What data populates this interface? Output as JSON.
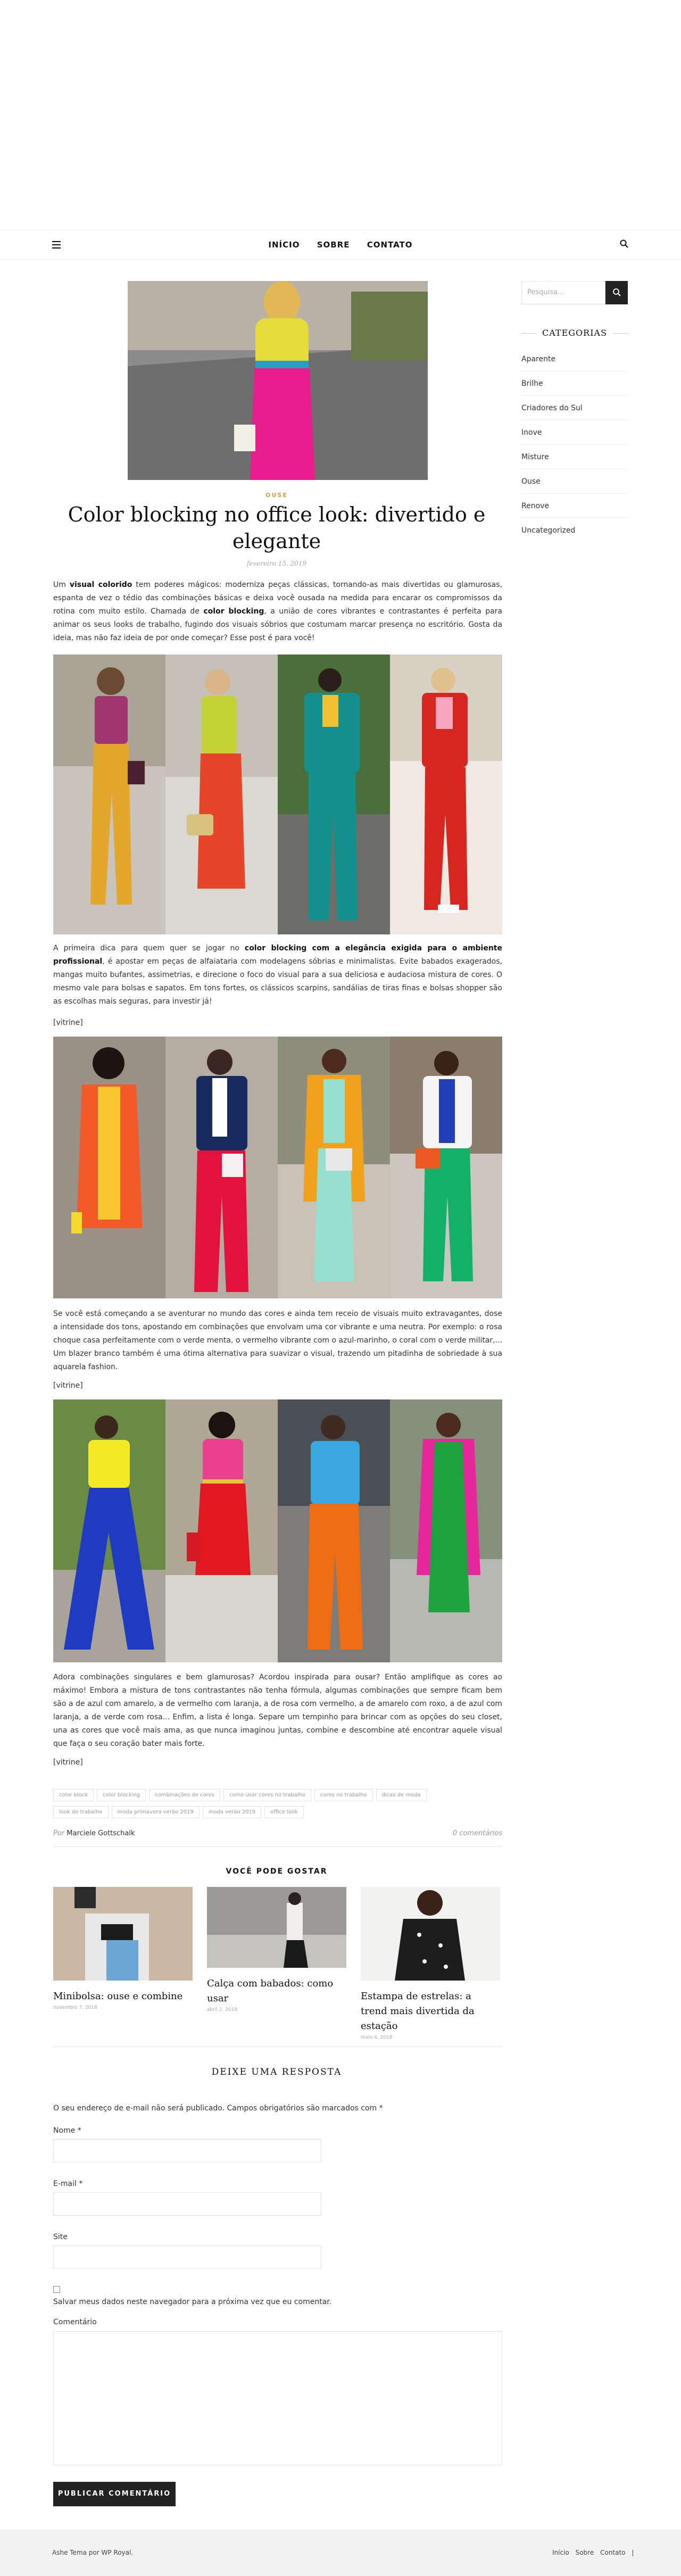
{
  "nav": {
    "items": [
      "INÍCIO",
      "SOBRE",
      "CONTATO"
    ]
  },
  "post": {
    "category": "OUSE",
    "title": "Color blocking no office look: divertido e elegante",
    "date": "fevereiro 15, 2019",
    "p1": {
      "a": "Um ",
      "b1": "visual colorido",
      "c": " tem poderes mágicos: moderniza peças clássicas, tornando-as mais divertidas ou glamurosas, espanta de vez o tédio das combinações básicas e deixa você ousada na medida para encarar os compromissos da rotina com muito estilo. Chamada de ",
      "b2": "color blocking",
      "d": ", a união de cores vibrantes e contrastantes é perfeita para animar os seus looks de trabalho, fugindo dos visuais sóbrios que costumam marcar presença no escritório. Gosta da ideia, mas não faz ideia de por onde começar? Esse post é para você!"
    },
    "p2": {
      "a": "A primeira dica para quem quer se jogar no ",
      "b1": "color blocking com a elegância exigida para o ambiente profissional",
      "c": ", é apostar em peças de alfaiataria com modelagens sóbrias e minimalistas. Evite babados exagerados, mangas muito bufantes, assimetrias, e direcione o foco do visual para a sua deliciosa e audaciosa mistura de cores. O mesmo vale para bolsas e sapatos. Em tons fortes, os clássicos scarpins, sandálias de tiras finas e bolsas shopper são as escolhas mais seguras, para investir já!"
    },
    "p3": "Se você está começando a se aventurar no mundo das cores e ainda tem receio de visuais muito extravagantes, dose a intensidade dos tons, apostando em combinações que envolvam uma cor vibrante e uma neutra. Por exemplo: o rosa choque casa perfeitamente com o verde menta, o vermelho vibrante com o azul-marinho, o coral com o verde militar,... Um blazer branco também é uma ótima alternativa para suavizar o visual, trazendo um pitadinha de sobriedade à sua aquarela fashion.",
    "p4": "Adora combinações singulares e bem glamurosas? Acordou inspirada para ousar? Então amplifique as cores ao máximo! Embora a mistura de tons contrastantes não tenha fórmula, algumas combinações que sempre ficam bem são a de azul com amarelo, a de vermelho com laranja, a de rosa com vermelho, a de amarelo com roxo, a de azul com laranja, a de verde com rosa... Enfim, a lista é longa. Separe um tempinho para brincar com as opções do seu closet,  una as cores que você mais ama, as que nunca imaginou juntas, combine e descombine até encontrar aquele visual que faça o seu coração bater mais forte.",
    "vitrine": "[vitrine]",
    "tags": [
      "color block",
      "color blocking",
      "combinações de cores",
      "como usar cores no trabalho",
      "cores no trabalho",
      "dicas de moda",
      "look de trabalho",
      "moda primavera verão 2019",
      "moda verão 2019",
      "office look"
    ],
    "author_prefix": "Por",
    "author": "Marciele Gottschalk",
    "comments": "0 comentários"
  },
  "related": {
    "heading": "VOCÊ PODE GOSTAR",
    "items": [
      {
        "title": "Minibolsa: ouse e combine",
        "date": "novembro 7, 2018"
      },
      {
        "title": "Calça com babados: como usar",
        "date": "abril 2, 2018"
      },
      {
        "title": "Estampa de estrelas: a trend mais divertida da estação",
        "date": "maio 4, 2018"
      }
    ]
  },
  "form": {
    "heading": "DEIXE UMA RESPOSTA",
    "note": "O seu endereço de e-mail não será publicado. Campos obrigatórios são marcados com *",
    "name_label": "Nome *",
    "email_label": "E-mail *",
    "site_label": "Site",
    "save_label": "Salvar meus dados neste navegador para a próxima vez que eu comentar.",
    "comment_label": "Comentário",
    "submit": "PUBLICAR COMENTÁRIO"
  },
  "sidebar": {
    "search_placeholder": "Pesquisa...",
    "heading": "CATEGORIAS",
    "items": [
      "Aparente",
      "Brilhe",
      "Criadores do Sul",
      "Inove",
      "Misture",
      "Ouse",
      "Renove",
      "Uncategorized"
    ]
  },
  "footer": {
    "credit": "Ashe Tema por WP Royal.",
    "links": [
      "Início",
      "Sobre",
      "Contato"
    ],
    "separator": "|"
  },
  "colors": {
    "accent": "#c9a24b",
    "dark": "#222222"
  }
}
